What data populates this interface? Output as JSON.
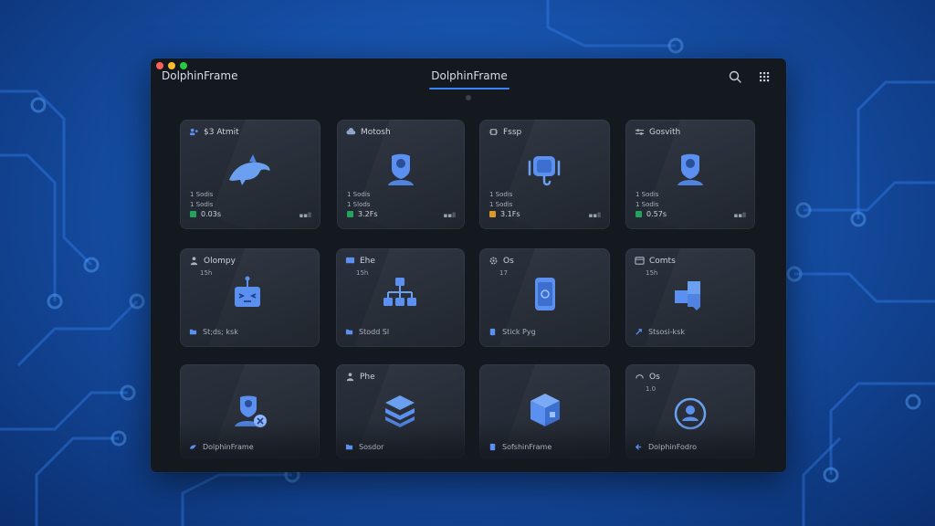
{
  "window": {
    "app_title": "DolphinFrame",
    "center_tab": "DolphinFrame",
    "controls": [
      "close",
      "minimize",
      "maximize"
    ],
    "toolbar_icons": [
      "search-icon",
      "grid-icon"
    ]
  },
  "colors": {
    "accent": "#3b82f6",
    "close": "#ff5f57",
    "minimize": "#febc2e",
    "maximize": "#28c840",
    "status_green": "#22a55a",
    "status_amber": "#d99a2b"
  },
  "cards": [
    {
      "title": "$3 Atmit",
      "icon": "dolphin-icon",
      "meta1": "1 Sodis",
      "meta2": "1 Sodis",
      "stat": "0.03s",
      "stat_color": "green",
      "signal": "▪▪ll"
    },
    {
      "title": "Motosh",
      "icon": "user-shield-icon",
      "meta1": "1 Sodis",
      "meta2": "1 Slods",
      "stat": "3.2Fs",
      "stat_color": "green",
      "signal": "▪▪ll"
    },
    {
      "title": "Fssp",
      "icon": "device-hook-icon",
      "meta1": "1 Sodis",
      "meta2": "1 Sodis",
      "stat": "3.1Fs",
      "stat_color": "amber",
      "signal": "▪▪ll"
    },
    {
      "title": "Gosvith",
      "icon": "user-shield-icon",
      "meta1": "1 Sodis",
      "meta2": "1 Sodis",
      "stat": "0.57s",
      "stat_color": "green",
      "signal": "▪▪ll"
    },
    {
      "title": "Olompy",
      "sub": "15h",
      "icon": "robot-icon",
      "foot": "St;ds; ksk"
    },
    {
      "title": "Ehe",
      "sub": "15h",
      "icon": "network-icon",
      "foot": "Stodd Sl"
    },
    {
      "title": "Os",
      "sub": "17",
      "icon": "phone-icon",
      "foot": "Stick Pyg"
    },
    {
      "title": "Comts",
      "sub": "15h",
      "icon": "puzzle-icon",
      "foot": "Stsosi-ksk"
    },
    {
      "title": "",
      "icon": "user-gear-icon",
      "foot": "DolphinFrame"
    },
    {
      "title": "Phe",
      "icon": "layers-icon",
      "foot": "Sosdor"
    },
    {
      "title": "",
      "icon": "cube-icon",
      "foot": "SofshinFrame"
    },
    {
      "title": "Os",
      "sub": "1.0",
      "icon": "user-circle-icon",
      "foot": "DolphinFodro"
    }
  ]
}
